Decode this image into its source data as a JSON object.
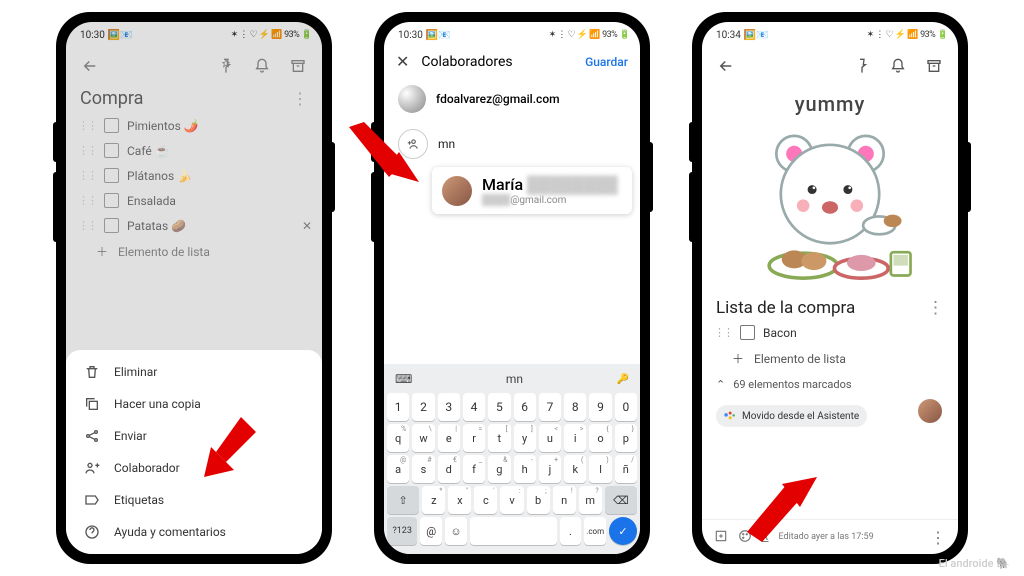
{
  "status": {
    "time1": "10:30",
    "time2": "10:30",
    "time3": "10:34",
    "icons": "📧",
    "right": "93%"
  },
  "phone1": {
    "title": "Compra",
    "items": [
      {
        "label": "Pimientos 🌶️"
      },
      {
        "label": "Café ☕"
      },
      {
        "label": "Plátanos 🍌"
      },
      {
        "label": "Ensalada"
      },
      {
        "label": "Patatas 🥔"
      }
    ],
    "add_label": "Elemento de lista",
    "sheet": {
      "delete": "Eliminar",
      "copy": "Hacer una copia",
      "send": "Enviar",
      "collab": "Colaborador",
      "labels": "Etiquetas",
      "help": "Ayuda y comentarios"
    }
  },
  "phone2": {
    "header": "Colaboradores",
    "save": "Guardar",
    "owner_email": "fdoalvarez@gmail.com",
    "typed": "mn",
    "suggestion": {
      "name": "María",
      "email_suffix": "@gmail.com"
    },
    "kbd_suggestion": "mn",
    "rows": {
      "nums": [
        "1",
        "2",
        "3",
        "4",
        "5",
        "6",
        "7",
        "8",
        "9",
        "0"
      ],
      "r1": [
        "q",
        "w",
        "e",
        "r",
        "t",
        "y",
        "u",
        "i",
        "o",
        "p"
      ],
      "r2": [
        "a",
        "s",
        "d",
        "f",
        "g",
        "h",
        "j",
        "k",
        "l",
        "ñ"
      ],
      "r3": [
        "z",
        "x",
        "c",
        "v",
        "b",
        "n",
        "m"
      ],
      "sym": "?123",
      "at": "@",
      "com": ".com"
    }
  },
  "phone3": {
    "img_text": "yummy",
    "title": "Lista de la compra",
    "items": [
      {
        "label": "Bacon"
      }
    ],
    "add_label": "Elemento de lista",
    "marked": "69 elementos marcados",
    "chip": "Movido desde el Asistente",
    "edited": "Editado ayer a las 17:59"
  },
  "watermark": "El androide"
}
